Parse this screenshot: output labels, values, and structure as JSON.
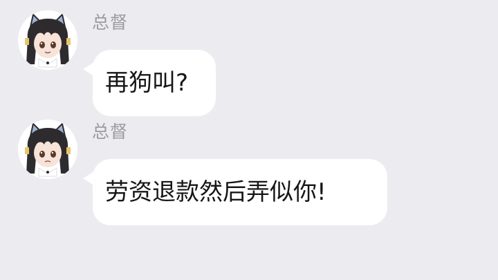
{
  "messages": [
    {
      "sender": "总督",
      "text": "再狗叫?",
      "avatar_icon": "anime-girl-cat-ears-avatar"
    },
    {
      "sender": "总督",
      "text": "劳资退款然后弄似你!",
      "avatar_icon": "anime-girl-cat-ears-avatar"
    }
  ],
  "colors": {
    "background": "#ececf0",
    "bubble": "#ffffff",
    "sender_name": "#9a9aa0",
    "message_text": "#161616"
  }
}
